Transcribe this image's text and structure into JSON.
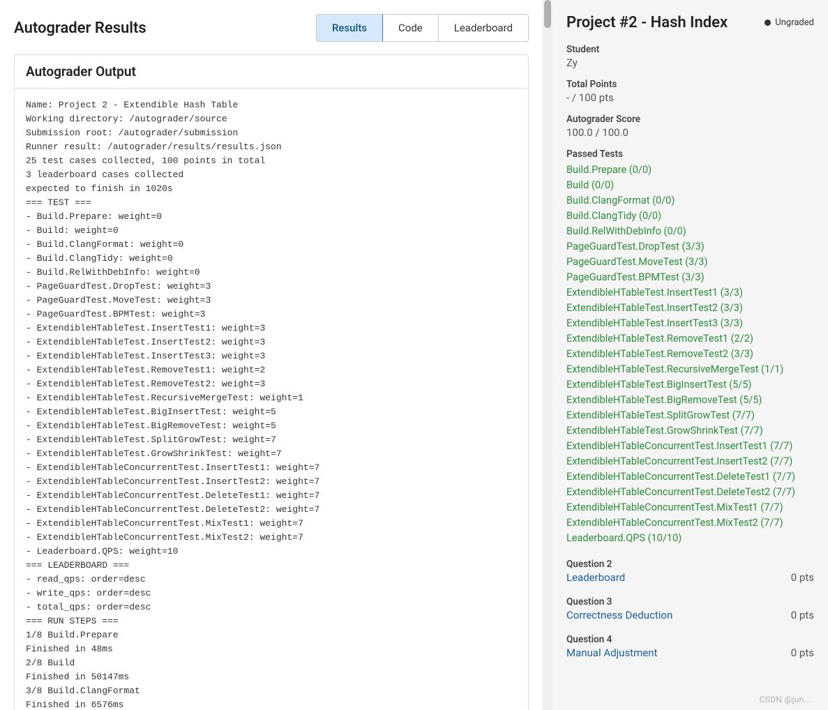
{
  "header": {
    "title": "Autograder Results",
    "tabs": [
      {
        "label": "Results",
        "active": true
      },
      {
        "label": "Code",
        "active": false
      },
      {
        "label": "Leaderboard",
        "active": false
      }
    ]
  },
  "output": {
    "title": "Autograder Output",
    "lines": [
      "Name: Project 2 - Extendible Hash Table",
      "Working directory: /autograder/source",
      "Submission root: /autograder/submission",
      "Runner result: /autograder/results/results.json",
      "25 test cases collected, 100 points in total",
      "3 leaderboard cases collected",
      "expected to finish in 1020s",
      "=== TEST ===",
      "- Build.Prepare: weight=0",
      "- Build: weight=0",
      "- Build.ClangFormat: weight=0",
      "- Build.ClangTidy: weight=0",
      "- Build.RelWithDebInfo: weight=0",
      "- PageGuardTest.DropTest: weight=3",
      "- PageGuardTest.MoveTest: weight=3",
      "- PageGuardTest.BPMTest: weight=3",
      "- ExtendibleHTableTest.InsertTest1: weight=3",
      "- ExtendibleHTableTest.InsertTest2: weight=3",
      "- ExtendibleHTableTest.InsertTest3: weight=3",
      "- ExtendibleHTableTest.RemoveTest1: weight=2",
      "- ExtendibleHTableTest.RemoveTest2: weight=3",
      "- ExtendibleHTableTest.RecursiveMergeTest: weight=1",
      "- ExtendibleHTableTest.BigInsertTest: weight=5",
      "- ExtendibleHTableTest.BigRemoveTest: weight=5",
      "- ExtendibleHTableTest.SplitGrowTest: weight=7",
      "- ExtendibleHTableTest.GrowShrinkTest: weight=7",
      "- ExtendibleHTableConcurrentTest.InsertTest1: weight=7",
      "- ExtendibleHTableConcurrentTest.InsertTest2: weight=7",
      "- ExtendibleHTableConcurrentTest.DeleteTest1: weight=7",
      "- ExtendibleHTableConcurrentTest.DeleteTest2: weight=7",
      "- ExtendibleHTableConcurrentTest.MixTest1: weight=7",
      "- ExtendibleHTableConcurrentTest.MixTest2: weight=7",
      "- Leaderboard.QPS: weight=10",
      "=== LEADERBOARD ===",
      "- read_qps: order=desc",
      "- write_qps: order=desc",
      "- total_qps: order=desc",
      "=== RUN STEPS ===",
      "1/8 Build.Prepare",
      "Finished in 48ms",
      "2/8 Build",
      "Finished in 50147ms",
      "3/8 Build.ClangFormat",
      "Finished in 6576ms"
    ]
  },
  "sidebar": {
    "project_title": "Project #2 - Hash Index",
    "status": "Ungraded",
    "student_label": "Student",
    "student_value": "Zy",
    "total_points_label": "Total Points",
    "total_points_value": "- / 100 pts",
    "autograder_score_label": "Autograder Score",
    "autograder_score_value": "100.0 / 100.0",
    "passed_tests_label": "Passed Tests",
    "passed_tests": [
      "Build.Prepare (0/0)",
      "Build (0/0)",
      "Build.ClangFormat (0/0)",
      "Build.ClangTidy (0/0)",
      "Build.RelWithDebInfo (0/0)",
      "PageGuardTest.DropTest (3/3)",
      "PageGuardTest.MoveTest (3/3)",
      "PageGuardTest.BPMTest (3/3)",
      "ExtendibleHTableTest.InsertTest1 (3/3)",
      "ExtendibleHTableTest.InsertTest2 (3/3)",
      "ExtendibleHTableTest.InsertTest3 (3/3)",
      "ExtendibleHTableTest.RemoveTest1 (2/2)",
      "ExtendibleHTableTest.RemoveTest2 (3/3)",
      "ExtendibleHTableTest.RecursiveMergeTest (1/1)",
      "ExtendibleHTableTest.BigInsertTest (5/5)",
      "ExtendibleHTableTest.BigRemoveTest (5/5)",
      "ExtendibleHTableTest.SplitGrowTest (7/7)",
      "ExtendibleHTableTest.GrowShrinkTest (7/7)",
      "ExtendibleHTableConcurrentTest.InsertTest1 (7/7)",
      "ExtendibleHTableConcurrentTest.InsertTest2 (7/7)",
      "ExtendibleHTableConcurrentTest.DeleteTest1 (7/7)",
      "ExtendibleHTableConcurrentTest.DeleteTest2 (7/7)",
      "ExtendibleHTableConcurrentTest.MixTest1 (7/7)",
      "ExtendibleHTableConcurrentTest.MixTest2 (7/7)",
      "Leaderboard.QPS (10/10)"
    ],
    "questions": [
      {
        "heading": "Question 2",
        "link": "Leaderboard",
        "pts": "0 pts"
      },
      {
        "heading": "Question 3",
        "link": "Correctness Deduction",
        "pts": "0 pts"
      },
      {
        "heading": "Question 4",
        "link": "Manual Adjustment",
        "pts": "0 pts"
      }
    ]
  },
  "watermark": "CSDN @jun..."
}
